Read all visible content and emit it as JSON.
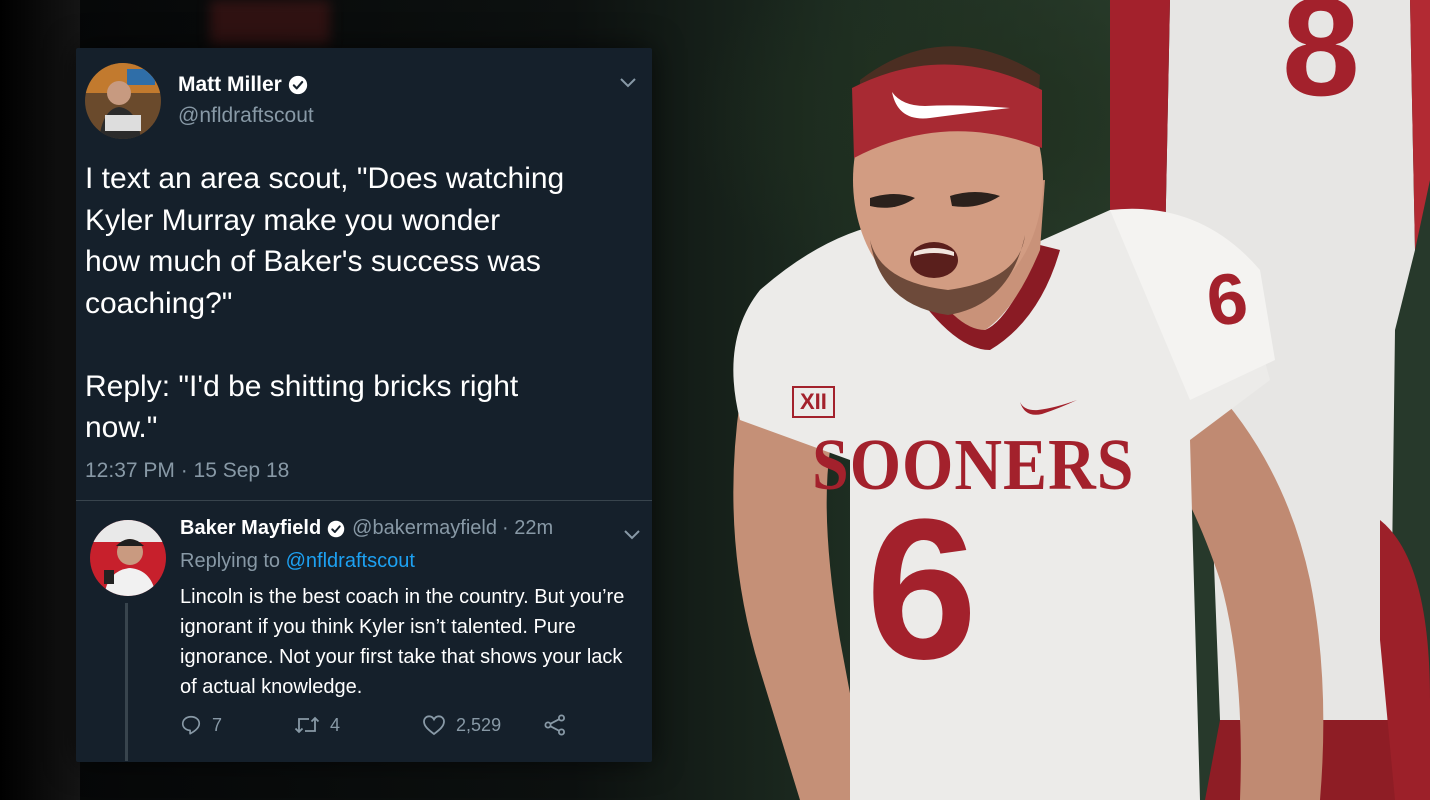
{
  "tweet_main": {
    "display_name": "Matt Miller",
    "handle": "@nfldraftscout",
    "text": "I text an area scout, \"Does watching\nKyler Murray make you wonder\nhow much of Baker's success was\ncoaching?\"\n\nReply: \"I'd be shitting bricks right\nnow.\"",
    "timestamp": "12:37 PM · 15 Sep 18",
    "verified_icon": "verified-badge-icon",
    "menu_icon": "chevron-down-icon"
  },
  "tweet_reply": {
    "display_name": "Baker Mayfield",
    "handle": "@bakermayfield",
    "age": "· 22m",
    "replying_prefix": "Replying to ",
    "replying_to": "@nfldraftscout",
    "text": "Lincoln is the best coach in the country. But you’re ignorant if you think Kyler isn’t talented. Pure ignorance. Not your first take that shows your lack of actual knowledge.",
    "replies": "7",
    "retweets": "4",
    "likes": "2,529",
    "icons": [
      "reply-icon",
      "retweet-icon",
      "like-icon",
      "share-icon"
    ]
  },
  "photo": {
    "jersey_text": "SOONERS",
    "jersey_number": "6",
    "conference_logo": "XII"
  },
  "colors": {
    "card_bg": "#15202b",
    "muted_text": "#8899a6",
    "link_blue": "#1da1f2",
    "crimson": "#a3212c"
  }
}
